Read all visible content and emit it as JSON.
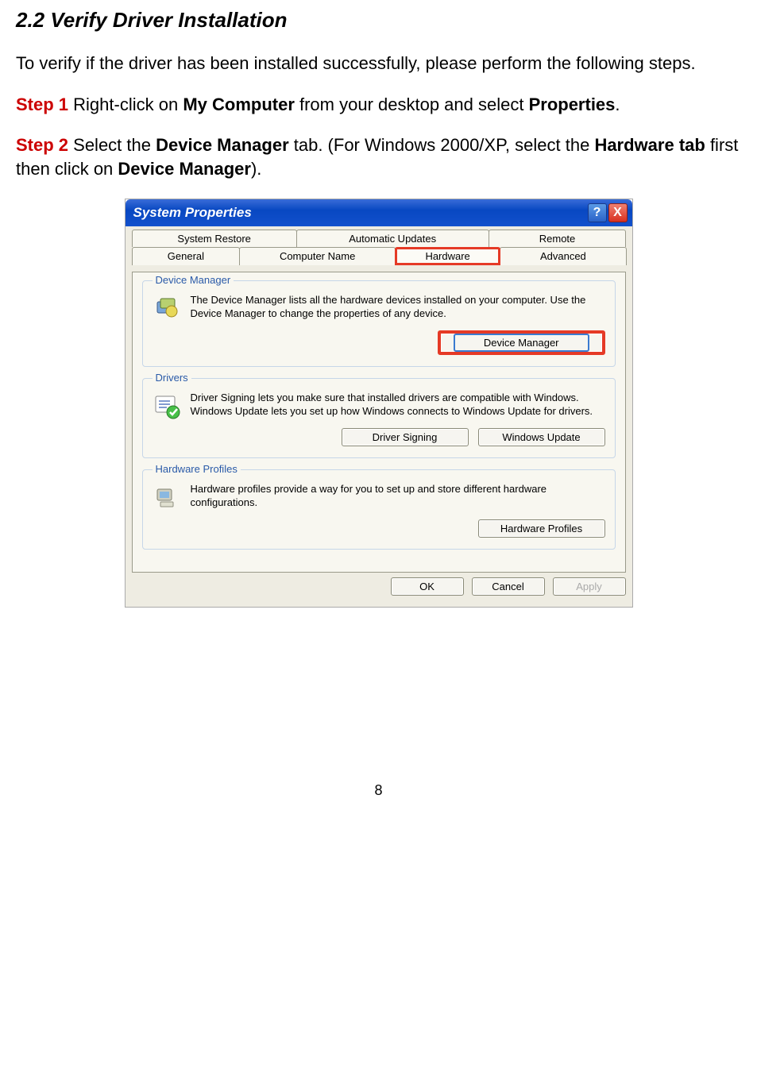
{
  "heading": "2.2 Verify Driver Installation",
  "intro": "To verify if the driver has been installed successfully, please perform the following steps.",
  "step1": {
    "label": "Step 1",
    "before": " Right-click on ",
    "bold1": "My Computer",
    "mid": " from your desktop and select ",
    "bold2": "Properties",
    "after": "."
  },
  "step2": {
    "label": "Step 2",
    "t1": " Select the ",
    "b1": "Device Manager",
    "t2": " tab. (For Windows 2000/XP, select the ",
    "b2": "Hardware tab",
    "t3": " first then click on ",
    "b3": "Device Manager",
    "t4": ")."
  },
  "dialog": {
    "title": "System Properties",
    "help": "?",
    "close": "X",
    "tabs": {
      "row1": [
        "System Restore",
        "Automatic Updates",
        "Remote"
      ],
      "row2": [
        "General",
        "Computer Name",
        "Hardware",
        "Advanced"
      ]
    },
    "device_manager": {
      "label": "Device Manager",
      "text": "The Device Manager lists all the hardware devices installed on your computer. Use the Device Manager to change the properties of any device.",
      "button": "Device Manager"
    },
    "drivers": {
      "label": "Drivers",
      "text": "Driver Signing lets you make sure that installed drivers are compatible with Windows. Windows Update lets you set up how Windows connects to Windows Update for drivers.",
      "button1": "Driver Signing",
      "button2": "Windows Update"
    },
    "hardware_profiles": {
      "label": "Hardware Profiles",
      "text": "Hardware profiles provide a way for you to set up and store different hardware configurations.",
      "button": "Hardware Profiles"
    },
    "ok": "OK",
    "cancel": "Cancel",
    "apply": "Apply"
  },
  "page_number": "8"
}
